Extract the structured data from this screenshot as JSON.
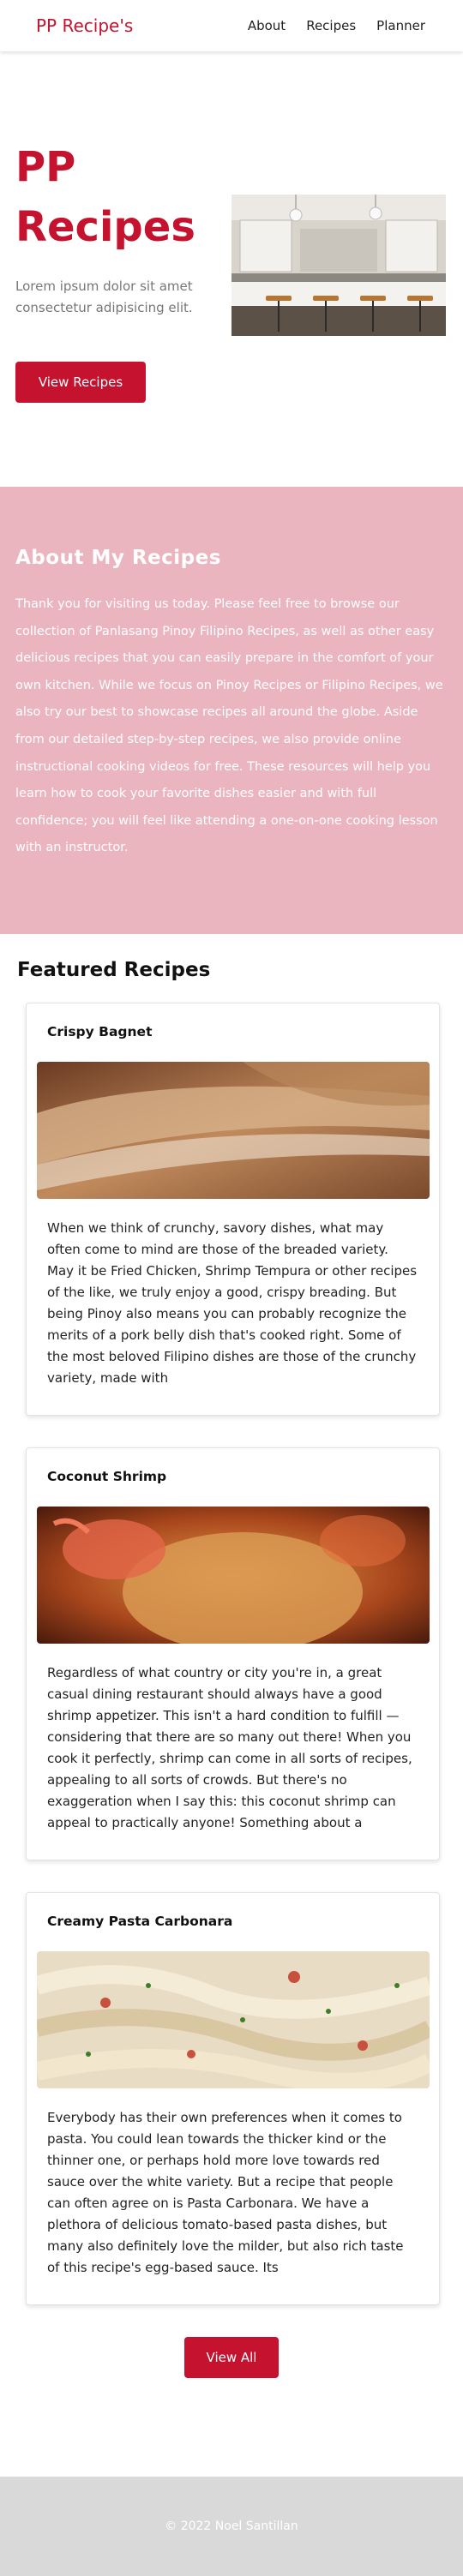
{
  "header": {
    "brand": "PP Recipe's",
    "nav": [
      "About",
      "Recipes",
      "Planner"
    ]
  },
  "hero": {
    "title": "PP Recipes",
    "subtitle": "Lorem ipsum dolor sit amet consectetur adipisicing elit.",
    "button": "View Recipes"
  },
  "about": {
    "heading": "About My Recipes",
    "body": "Thank you for visiting us today. Please feel free to browse our collection of Panlasang Pinoy Filipino Recipes, as well as other easy delicious recipes that you can easily prepare in the comfort of your own kitchen. While we focus on Pinoy Recipes or Filipino Recipes, we also try our best to showcase recipes all around the globe. Aside from our detailed step-by-step recipes, we also provide online instructional cooking videos for free. These resources will help you learn how to cook your favorite dishes easier and with full confidence; you will feel like attending a one-on-one cooking lesson with an instructor."
  },
  "featured": {
    "heading": "Featured Recipes",
    "cards": [
      {
        "title": "Crispy Bagnet",
        "text": "When we think of crunchy, savory dishes, what may often come to mind are those of the breaded variety. May it be Fried Chicken, Shrimp Tempura or other recipes of the like, we truly enjoy a good, crispy breading. But being Pinoy also means you can probably recognize the merits of a pork belly dish that's cooked right. Some of the most beloved Filipino dishes are those of the crunchy variety, made with"
      },
      {
        "title": "Coconut Shrimp",
        "text": "Regardless of what country or city you're in, a great casual dining restaurant should always have a good shrimp appetizer. This isn't a hard condition to fulfill — considering that there are so many out there! When you cook it perfectly, shrimp can come in all sorts of recipes, appealing to all sorts of crowds. But there's no exaggeration when I say this: this coconut shrimp can appeal to practically anyone! Something about a"
      },
      {
        "title": "Creamy Pasta Carbonara",
        "text": "Everybody has their own preferences when it comes to pasta. You could lean towards the thicker kind or the thinner one, or perhaps hold more love towards red sauce over the white variety. But a recipe that people can often agree on is Pasta Carbonara. We have a plethora of delicious tomato-based pasta dishes, but many also definitely love the milder, but also rich taste of this recipe's egg-based sauce. Its"
      }
    ],
    "view_all": "View All"
  },
  "footer": {
    "text": "© 2022 Noel Santillan"
  },
  "colors": {
    "accent": "#c4122f",
    "about_bg": "#ebb5c0",
    "footer_bg": "#d9d9d9"
  }
}
